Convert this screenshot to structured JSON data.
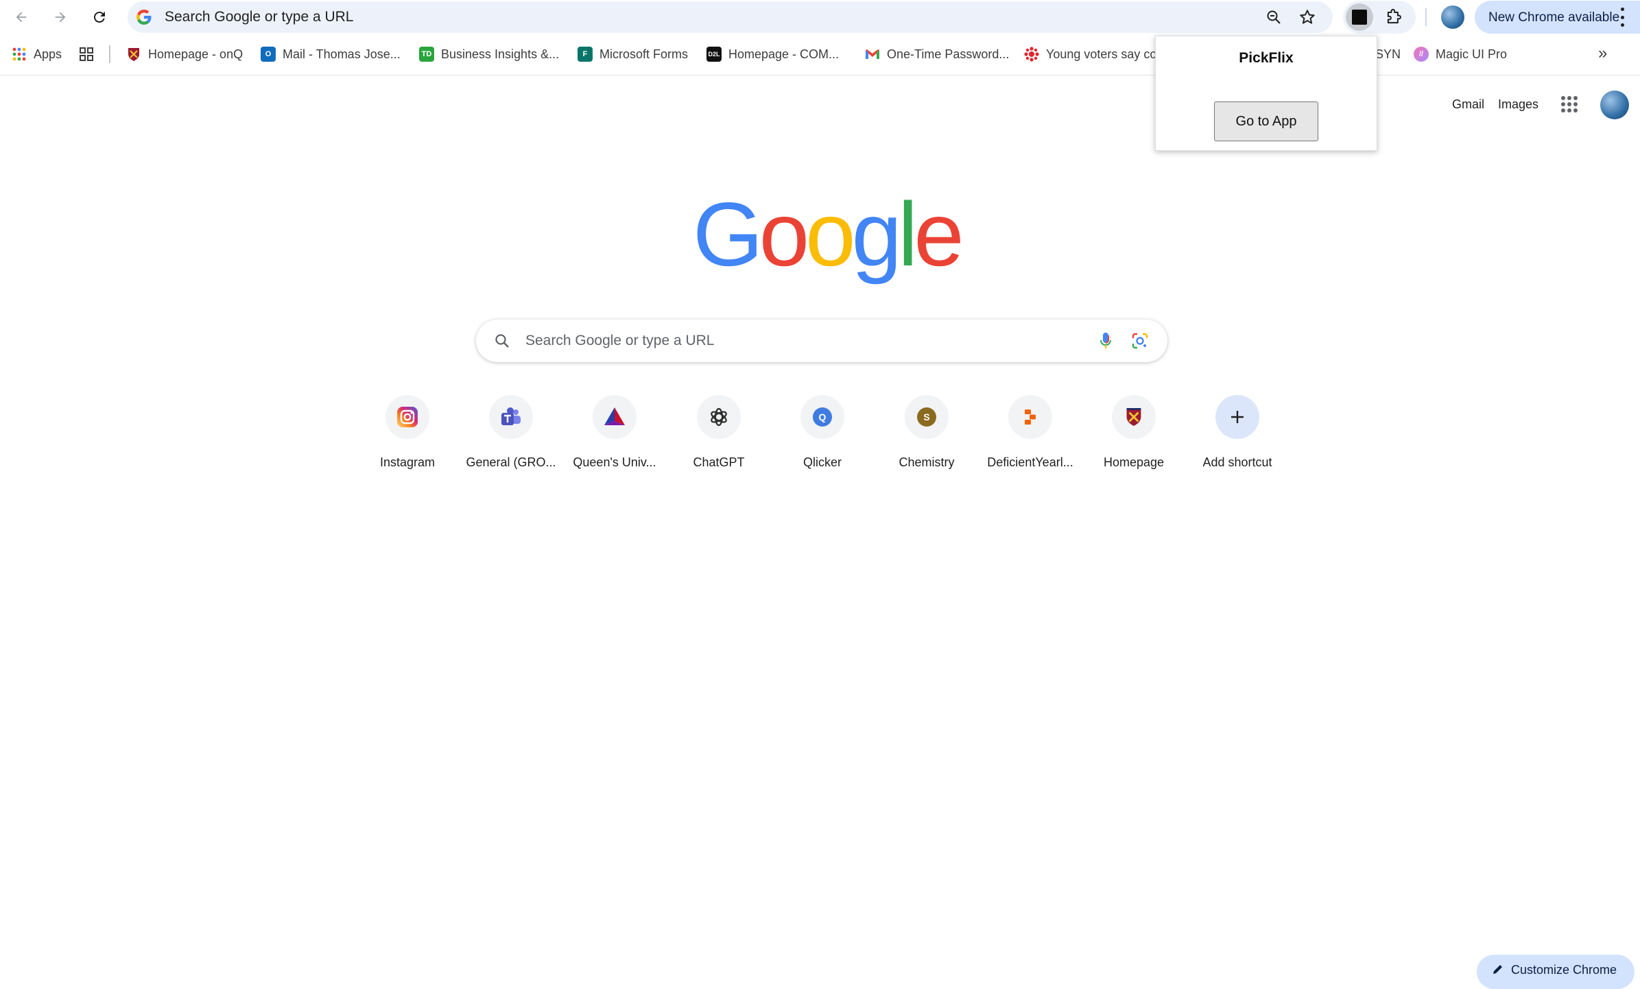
{
  "toolbar": {
    "omnibox_text": "Search Google or type a URL",
    "new_chrome_label": "New Chrome available"
  },
  "bookmarks": {
    "items": [
      {
        "label": "Apps",
        "icon": "apps-grid-icon"
      },
      {
        "label": "",
        "icon": "tab-groups-icon"
      },
      {
        "label": "Homepage - onQ",
        "icon": "queens-crest-icon"
      },
      {
        "label": "Mail - Thomas Jose...",
        "icon": "outlook-icon"
      },
      {
        "label": "Business Insights &...",
        "icon": "td-icon"
      },
      {
        "label": "Microsoft Forms",
        "icon": "forms-icon"
      },
      {
        "label": "Homepage - COM...",
        "icon": "d2l-icon"
      },
      {
        "label": "One-Time Password...",
        "icon": "gmail-icon"
      },
      {
        "label": "Young voters say co",
        "icon": "cbc-icon"
      },
      {
        "label": "SYN",
        "icon": ""
      },
      {
        "label": "Magic UI Pro",
        "icon": "magicui-icon"
      }
    ]
  },
  "popup": {
    "title": "PickFlix",
    "button_label": "Go to App"
  },
  "header": {
    "gmail": "Gmail",
    "images": "Images"
  },
  "logo_text": "Google",
  "search": {
    "placeholder": "Search Google or type a URL"
  },
  "shortcuts": [
    {
      "label": "Instagram",
      "icon": "instagram-icon"
    },
    {
      "label": "General (GRO...",
      "icon": "teams-icon"
    },
    {
      "label": "Queen's Univ...",
      "icon": "queens-prism-icon"
    },
    {
      "label": "ChatGPT",
      "icon": "chatgpt-icon"
    },
    {
      "label": "Qlicker",
      "icon": "qlicker-icon",
      "letter": "Q"
    },
    {
      "label": "Chemistry",
      "icon": "chemistry-icon",
      "letter": "S"
    },
    {
      "label": "DeficientYearl...",
      "icon": "replit-icon"
    },
    {
      "label": "Homepage",
      "icon": "queens-crest-icon"
    },
    {
      "label": "Add shortcut",
      "icon": "plus-icon"
    }
  ],
  "customize_label": "Customize Chrome",
  "colors": {
    "accent": "#d3e3fd",
    "omnibox_bg": "#edf2fa",
    "google_blue": "#4285f4",
    "google_red": "#ea4335",
    "google_yellow": "#fbbc05",
    "google_green": "#34a853"
  }
}
